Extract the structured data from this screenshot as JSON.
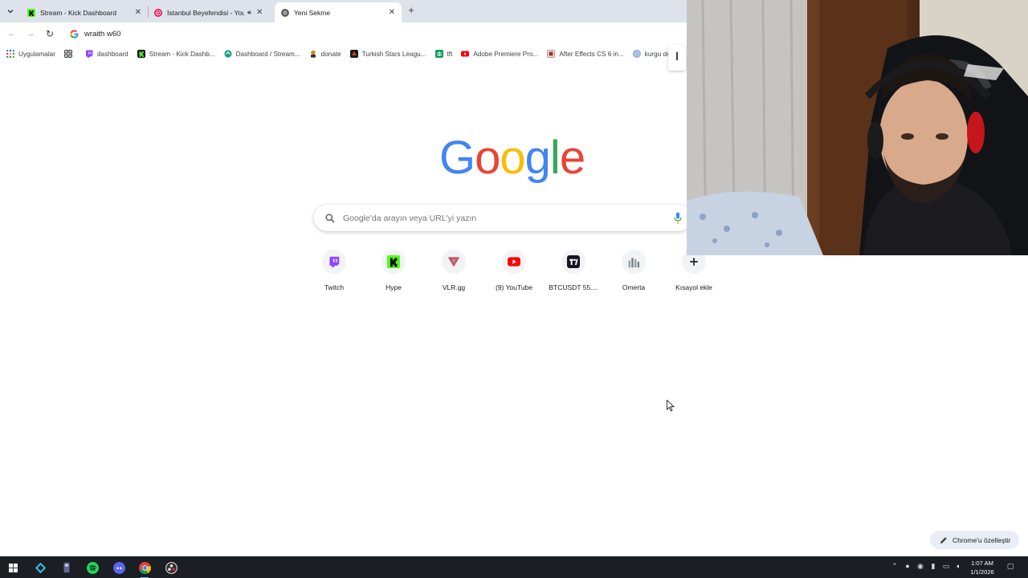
{
  "browser": {
    "tabs": [
      {
        "label": "Stream - Kick Dashboard",
        "favicon": "kick-icon",
        "active": false
      },
      {
        "label": "İstanbul Beyefendisi - YouTube",
        "favicon": "youtube-music-icon",
        "active": false,
        "audio": true
      },
      {
        "label": "Yeni Sekme",
        "favicon": "chrome-icon",
        "active": true
      }
    ],
    "new_tab_symbol": "+",
    "omnibox": {
      "value": "wraith w60"
    },
    "bookmarks": [
      {
        "label": "Uygulamalar",
        "icon": "apps-grid-icon"
      },
      {
        "label": "",
        "icon": "grid-icon"
      },
      {
        "label": "dashboard",
        "icon": "twitch-icon"
      },
      {
        "label": "Stream - Kick Dashb...",
        "icon": "kick-icon"
      },
      {
        "label": "Dashboard / Stream...",
        "icon": "dashboard-icon"
      },
      {
        "label": "donate",
        "icon": "donate-icon"
      },
      {
        "label": "Turkish Stars Leagu...",
        "icon": "league-icon"
      },
      {
        "label": "tft",
        "icon": "sheets-icon"
      },
      {
        "label": "Adobe Premiere Pro...",
        "icon": "youtube-icon"
      },
      {
        "label": "After Effects CS 6 in...",
        "icon": "film-icon"
      },
      {
        "label": "kurgu dersi",
        "icon": "globe-icon"
      }
    ]
  },
  "newtab": {
    "logo_text": "Google",
    "search_placeholder": "Google'da arayın veya URL'yi yazın",
    "shortcuts": [
      {
        "label": "Twitch",
        "icon": "twitch-icon"
      },
      {
        "label": "Hype",
        "icon": "kick-icon"
      },
      {
        "label": "VLR.gg",
        "icon": "vlr-icon"
      },
      {
        "label": "(9) YouTube",
        "icon": "youtube-icon"
      },
      {
        "label": "BTCUSDT 55....",
        "icon": "tradingview-icon"
      },
      {
        "label": "Omerta",
        "icon": "omerta-icon"
      },
      {
        "label": "Kısayol ekle",
        "icon": "plus-icon"
      }
    ],
    "customize_label": "Chrome'u özelleştir"
  },
  "taskbar": {
    "clock_time": "1:07 AM",
    "clock_date": "1/1/2026",
    "apps": [
      "windows-start-icon",
      "kodi-icon",
      "app-icon",
      "spotify-icon",
      "discord-icon",
      "chrome-icon",
      "obs-icon"
    ]
  },
  "colors": {
    "google_blue": "#4285F4",
    "google_red": "#EA4335",
    "google_yellow": "#FBBC05",
    "google_green": "#34A853",
    "tabstrip": "#dee3eb",
    "taskbar": "#1b1f24"
  }
}
